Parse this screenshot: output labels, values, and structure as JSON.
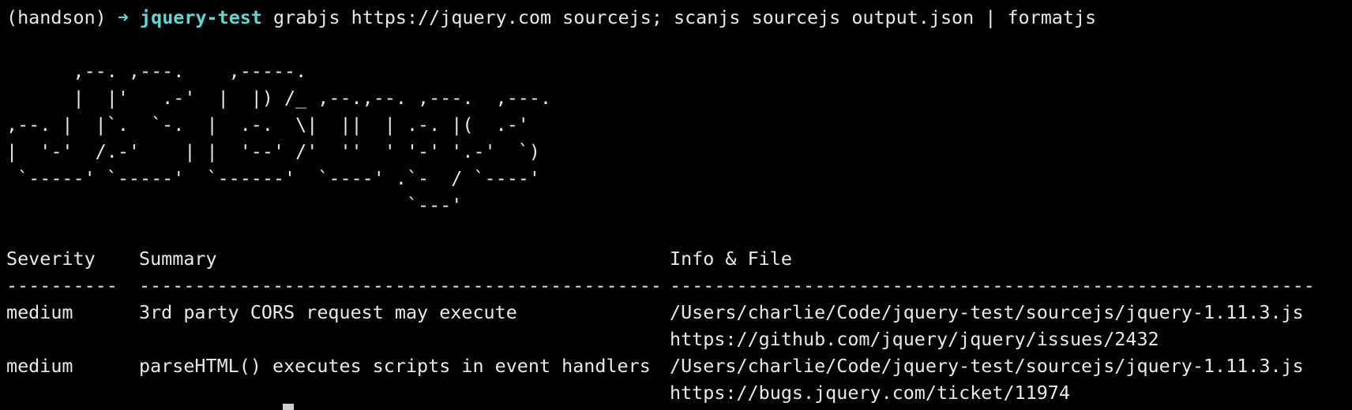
{
  "prompt": {
    "venv": "(handson)",
    "arrow": "➜",
    "directory": "jquery-test",
    "command": "grabjs https://jquery.com sourcejs; scanjs sourcejs output.json | formatjs"
  },
  "banner_lines": [
    "      ,--. ,---.    ,-----.",
    "      |  |'   .-'  |  |) /_ ,--.,--. ,---.  ,---.",
    ",--. |  |`.  `-.  |  .-.  \\|  ||  | .-. |(  .-'",
    "|  '-'  /.-'    | |  '--' /'  ''  ' '-' '.-'  `)",
    " `-----' `-----'  `------'  `----' .`-  / `----'",
    "                                    `---'"
  ],
  "table": {
    "headers": [
      "Severity",
      "Summary",
      "Info & File"
    ],
    "separators": [
      "----------",
      "-----------------------------------------------",
      "----------------------------------------------------------"
    ],
    "rows": [
      {
        "severity": "medium",
        "summary": "3rd party CORS request may execute",
        "file": "/Users/charlie/Code/jquery-test/sourcejs/jquery-1.11.3.js",
        "info": "https://github.com/jquery/jquery/issues/2432"
      },
      {
        "severity": "medium",
        "summary": "parseHTML() executes scripts in event handlers",
        "file": "/Users/charlie/Code/jquery-test/sourcejs/jquery-1.11.3.js",
        "info": "https://bugs.jquery.com/ticket/11974"
      }
    ]
  },
  "colors": {
    "background": "#000000",
    "text": "#e8e8e8",
    "prompt_accent": "#5fd7d7"
  }
}
